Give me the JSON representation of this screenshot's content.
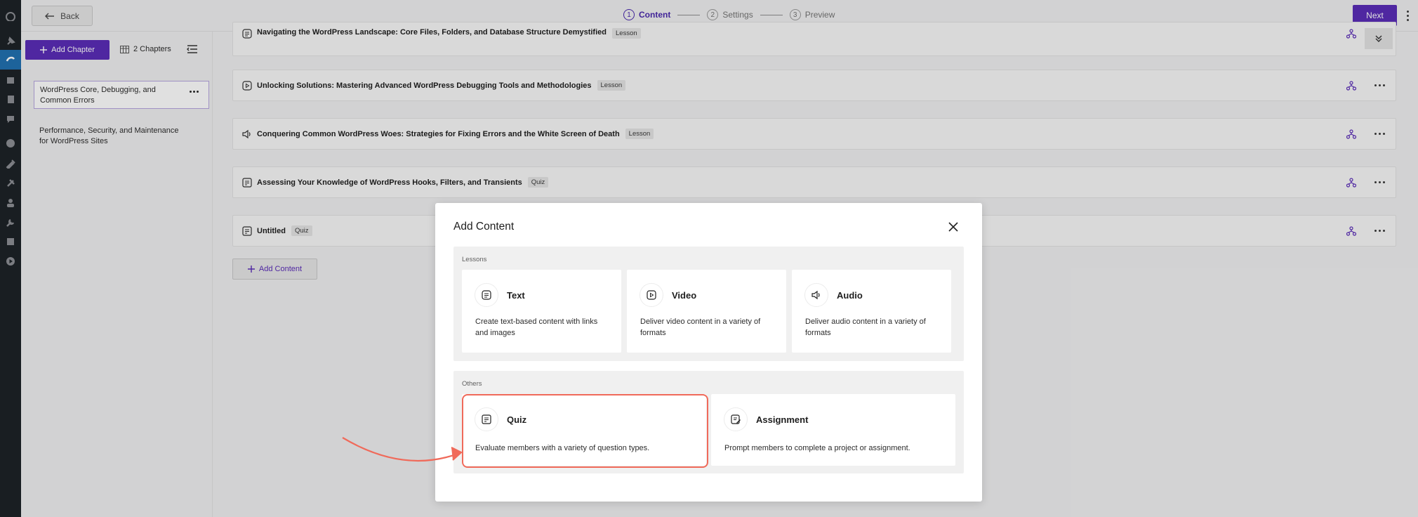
{
  "wp_rail": {
    "icons": [
      "dashboard-icon",
      "pin-icon",
      "course-icon",
      "media-icon",
      "pages-icon",
      "comments-icon",
      "astra-icon",
      "appearance-icon",
      "plugins-icon",
      "users-icon",
      "tools-icon",
      "settings-icon",
      "play-icon"
    ]
  },
  "topbar": {
    "back_label": "Back",
    "steps": [
      {
        "num": "1",
        "label": "Content"
      },
      {
        "num": "2",
        "label": "Settings"
      },
      {
        "num": "3",
        "label": "Preview"
      }
    ],
    "next_label": "Next"
  },
  "chapters": {
    "add_label": "Add Chapter",
    "count_label": "2 Chapters",
    "items": [
      {
        "label": "WordPress Core, Debugging, and Common Errors"
      },
      {
        "label": "Performance, Security, and Maintenance for WordPress Sites"
      }
    ]
  },
  "content": {
    "rows": [
      {
        "title": "Navigating the WordPress Landscape: Core Files, Folders, and Database Structure Demystified",
        "badge": "Lesson",
        "icon": "text-lesson-icon"
      },
      {
        "title": "Unlocking Solutions: Mastering Advanced WordPress Debugging Tools and Methodologies",
        "badge": "Lesson",
        "icon": "video-lesson-icon"
      },
      {
        "title": "Conquering Common WordPress Woes: Strategies for Fixing Errors and the White Screen of Death",
        "badge": "Lesson",
        "icon": "audio-lesson-icon"
      },
      {
        "title": "Assessing Your Knowledge of WordPress Hooks, Filters, and Transients",
        "badge": "Quiz",
        "icon": "quiz-icon"
      },
      {
        "title": "Untitled",
        "badge": "Quiz",
        "icon": "quiz-icon"
      }
    ],
    "add_content_label": "Add Content"
  },
  "modal": {
    "title": "Add Content",
    "lessons_label": "Lessons",
    "others_label": "Others",
    "lesson_cards": [
      {
        "title": "Text",
        "desc": "Create text-based content with links and images"
      },
      {
        "title": "Video",
        "desc": "Deliver video content in a variety of formats"
      },
      {
        "title": "Audio",
        "desc": "Deliver audio content in a variety of formats"
      }
    ],
    "other_cards": [
      {
        "title": "Quiz",
        "desc": "Evaluate members with a variety of question types."
      },
      {
        "title": "Assignment",
        "desc": "Prompt members to complete a project or assignment."
      }
    ]
  },
  "colors": {
    "accent": "#5b2db8",
    "highlight": "#f06a5a",
    "wp_rail": "#1d2327",
    "wp_active": "#2271b1"
  }
}
